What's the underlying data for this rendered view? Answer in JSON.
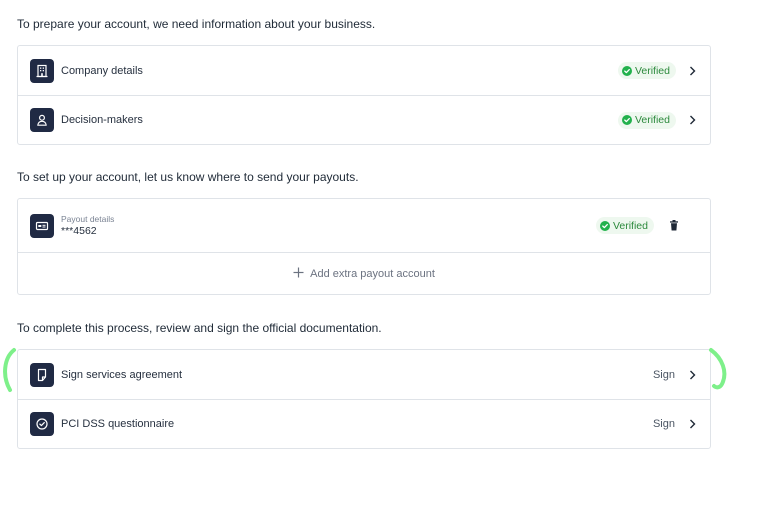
{
  "sections": {
    "business_intro": "To prepare your account, we need information about your business.",
    "payout_intro": "To set up your account, let us know where to send your payouts.",
    "docs_intro": "To complete this process, review and sign the official documentation."
  },
  "business": {
    "items": [
      {
        "label": "Company details",
        "status": "Verified",
        "icon": "building-icon"
      },
      {
        "label": "Decision-makers",
        "status": "Verified",
        "icon": "person-icon"
      }
    ]
  },
  "payout": {
    "caption": "Payout details",
    "account": "***4562",
    "status": "Verified",
    "add_label": "Add extra payout account"
  },
  "docs": {
    "items": [
      {
        "label": "Sign services agreement",
        "action": "Sign",
        "icon": "document-icon"
      },
      {
        "label": "PCI DSS questionnaire",
        "action": "Sign",
        "icon": "check-circle-icon"
      }
    ]
  },
  "colors": {
    "icon_bg": "#202a44",
    "verified_text": "#2c8a3c",
    "verified_bg": "#eef8ef",
    "annotation": "#7ef08a"
  }
}
